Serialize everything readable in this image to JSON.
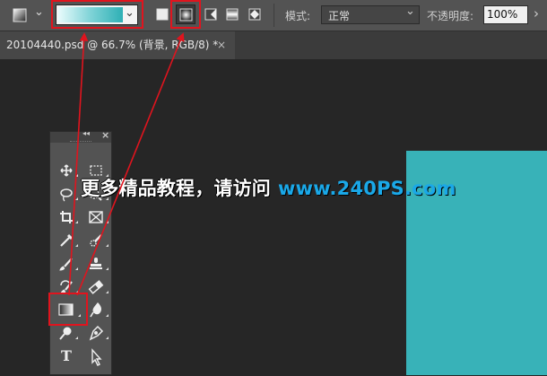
{
  "options_bar": {
    "gradient_dropdown_arrow": "⌄",
    "tool_preset_arrow": "⌄",
    "mode_label": "模式:",
    "mode_value": "正常",
    "opacity_label": "不透明度:",
    "opacity_value": "100%",
    "opacity_arrow": "›",
    "gradient_colors": [
      "#e8fbfc",
      "#7fd3d7",
      "#2eb0b5"
    ],
    "gradient_styles": [
      "linear-gradient",
      "radial-gradient",
      "angle-gradient",
      "reflected-gradient",
      "diamond-gradient"
    ],
    "selected_style": "radial-gradient"
  },
  "document_tab": {
    "title": "20104440.psd @ 66.7% (背景, RGB/8) *",
    "close": "×"
  },
  "tools_panel": {
    "collapse": "◂◂",
    "close": "×",
    "tools": [
      [
        "move-tool",
        "rectangular-marquee-tool"
      ],
      [
        "lasso-tool",
        "quick-selection-tool"
      ],
      [
        "crop-tool",
        "frame-tool"
      ],
      [
        "eyedropper-tool",
        "spot-healing-brush-tool"
      ],
      [
        "brush-tool",
        "clone-stamp-tool"
      ],
      [
        "history-brush-tool",
        "eraser-tool"
      ],
      [
        "gradient-tool",
        "blur-tool"
      ],
      [
        "dodge-tool",
        "pen-tool"
      ],
      [
        "type-tool",
        "path-selection-tool"
      ]
    ],
    "selected_tool": "gradient-tool",
    "type_tool_glyph": "T"
  },
  "watermark": {
    "text_cn": "更多精品教程，请访问",
    "url": "www.240PS.com"
  },
  "canvas": {
    "color": "#38b2b8"
  },
  "annotations": {
    "highlight_color": "#e0141e",
    "boxes": [
      "gradient-picker",
      "radial-gradient-button",
      "gradient-tool"
    ]
  }
}
